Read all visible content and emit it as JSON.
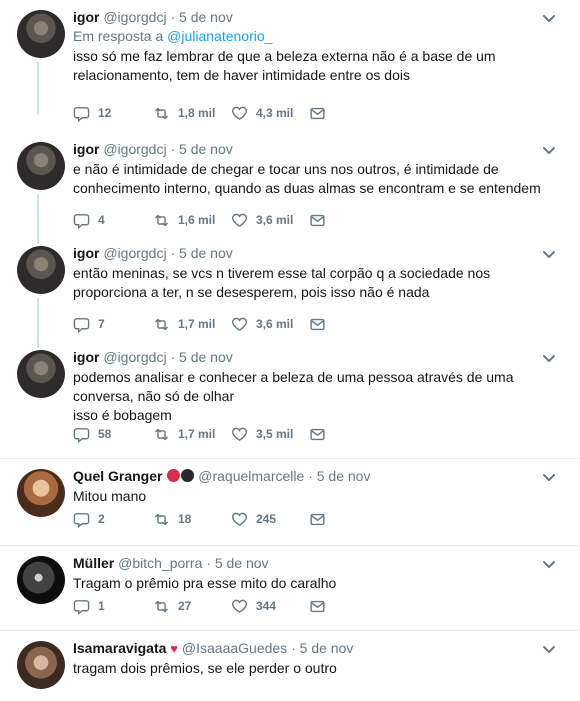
{
  "tweets": [
    {
      "name": "igor",
      "handle": "@igorgdcj",
      "time": "5 de nov",
      "reply_prefix": "Em resposta a ",
      "reply_to": "@julianatenorio_",
      "text_lines": [
        "isso só me faz lembrar de que a beleza externa não é a base de um",
        "relacionamento, tem de haver intimidade entre os dois"
      ],
      "replies": "12",
      "retweets": "1,8 mil",
      "likes": "4,3 mil"
    },
    {
      "name": "igor",
      "handle": "@igorgdcj",
      "time": "5 de nov",
      "text_lines": [
        "e não é intimidade de chegar e tocar uns nos outros, é intimidade de",
        "conhecimento interno, quando as duas almas se encontram e se entendem"
      ],
      "replies": "4",
      "retweets": "1,6 mil",
      "likes": "3,6 mil"
    },
    {
      "name": "igor",
      "handle": "@igorgdcj",
      "time": "5 de nov",
      "text_lines": [
        "então meninas, se vcs n tiverem esse tal corpão q a sociedade nos",
        "proporciona a ter, n se desesperem, pois isso não é nada"
      ],
      "replies": "7",
      "retweets": "1,7 mil",
      "likes": "3,6 mil"
    },
    {
      "name": "igor",
      "handle": "@igorgdcj",
      "time": "5 de nov",
      "text_lines": [
        "podemos analisar e conhecer a beleza de uma pessoa através de uma",
        "conversa, não só de olhar",
        "isso é bobagem"
      ],
      "replies": "58",
      "retweets": "1,7 mil",
      "likes": "3,5 mil"
    },
    {
      "name": "Quel Granger",
      "handle": "@raquelmarcelle",
      "time": "5 de nov",
      "text_lines": [
        "Mitou mano"
      ],
      "replies": "2",
      "retweets": "18",
      "likes": "245"
    },
    {
      "name": "Müller",
      "handle": "@bitch_porra",
      "time": "5 de nov",
      "text_lines": [
        "Tragam o prêmio pra esse mito do caralho"
      ],
      "replies": "1",
      "retweets": "27",
      "likes": "344"
    },
    {
      "name": "Isamaravigata",
      "handle": "@IsaaaaGuedes",
      "time": "5 de nov",
      "text_lines": [
        "tragam dois prêmios, se ele perder o outro"
      ]
    }
  ],
  "colors": {
    "link": "#1da1f2",
    "thread": "#cbe3f5",
    "muted": "#657786",
    "heart": "#e0245e"
  },
  "icons": {
    "reply": "reply-icon",
    "retweet": "retweet-icon",
    "like": "heart-icon",
    "message": "envelope-icon",
    "menu": "chevron-down-icon"
  }
}
